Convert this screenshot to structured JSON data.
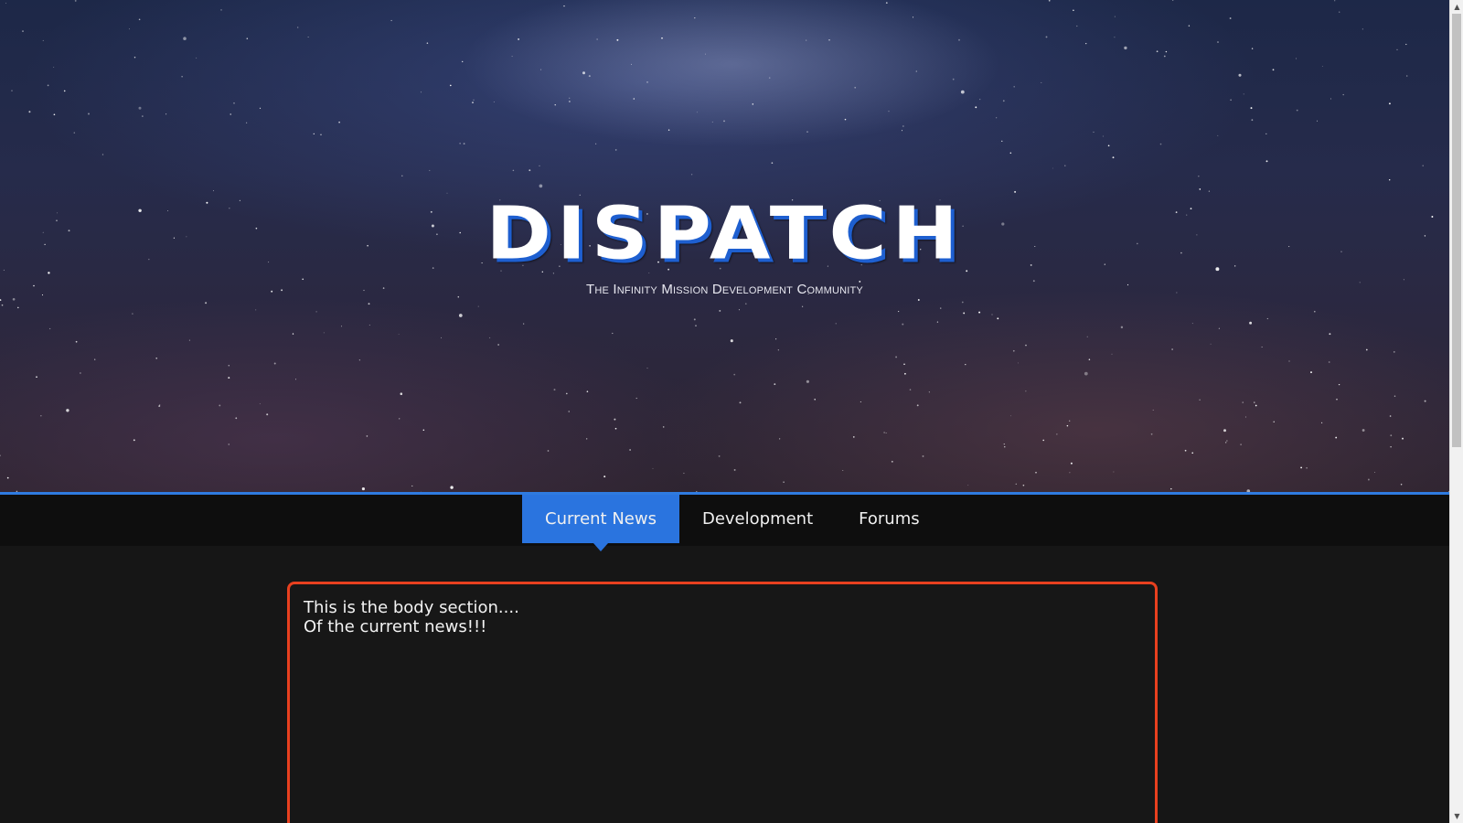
{
  "header": {
    "logo_text": "DISPATCH",
    "tagline": "The Infinity Mission Development Community"
  },
  "nav": {
    "items": [
      {
        "label": "Current News",
        "active": true
      },
      {
        "label": "Development",
        "active": false
      },
      {
        "label": "Forums",
        "active": false
      }
    ]
  },
  "content": {
    "lines": [
      "This is the body section....",
      "Of the current news!!!"
    ]
  },
  "colors": {
    "accent_blue": "#2a74df",
    "content_border": "#e8401f",
    "page_background": "#161616",
    "nav_background": "#0e0e0e"
  },
  "scrollbar": {
    "up_icon": "scroll-up-arrow-icon",
    "down_icon": "scroll-down-arrow-icon"
  }
}
